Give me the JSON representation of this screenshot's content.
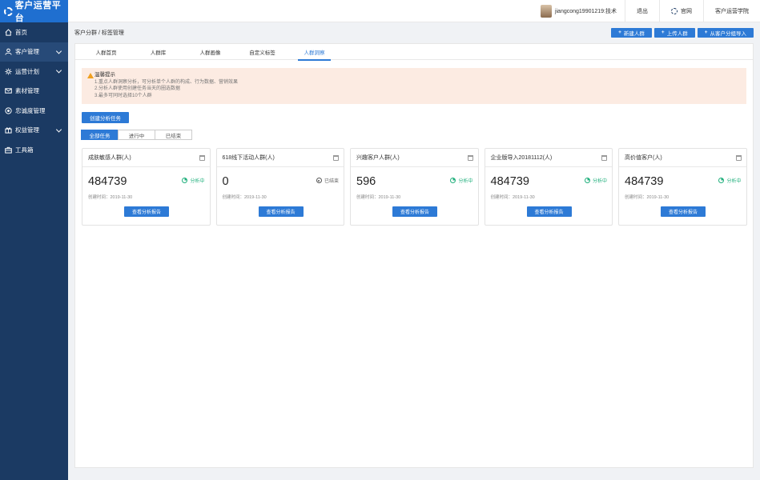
{
  "app": {
    "title": "客户运营平台"
  },
  "sidebar": {
    "items": [
      {
        "label": "首页",
        "icon": "home-icon",
        "expandable": false
      },
      {
        "label": "客户管理",
        "icon": "user-icon",
        "expandable": true
      },
      {
        "label": "运营计划",
        "icon": "gear-icon",
        "expandable": true
      },
      {
        "label": "素材管理",
        "icon": "mail-icon",
        "expandable": false
      },
      {
        "label": "忠诚度管理",
        "icon": "loyalty-icon",
        "expandable": false
      },
      {
        "label": "权益管理",
        "icon": "gift-icon",
        "expandable": true
      },
      {
        "label": "工具箱",
        "icon": "toolbox-icon",
        "expandable": false
      }
    ]
  },
  "topbar": {
    "user": "jiangcong19901219:技术",
    "logout": "退出",
    "official_site": "官网",
    "academy": "客户运营学院"
  },
  "breadcrumb": "客户分群 / 标签管理",
  "actions": {
    "new_group": "新建人群",
    "upload_group": "上传人群",
    "import_group": "从客户分组导入"
  },
  "tabs": [
    {
      "label": "人群首页",
      "active": false
    },
    {
      "label": "人群库",
      "active": false
    },
    {
      "label": "人群画像",
      "active": false
    },
    {
      "label": "自定义标签",
      "active": false
    },
    {
      "label": "人群洞察",
      "active": true
    }
  ],
  "tip": {
    "title": "温馨提示",
    "lines": [
      "1.重点人群洞察分析，可分析单个人群的构成、行为数据、营销效果",
      "2.分析人群使用创建任务当天的圈选数据",
      "3.最多可同时选择10个人群"
    ]
  },
  "create_task_label": "创建分析任务",
  "filter": {
    "options": [
      {
        "label": "全部任务",
        "active": true
      },
      {
        "label": "进行中",
        "active": false
      },
      {
        "label": "已结束",
        "active": false
      }
    ]
  },
  "cards": [
    {
      "name": "成肤敏感人群(人)",
      "count": "484739",
      "status": "分析中",
      "status_type": "running",
      "created": "创建时间：2019-11-30",
      "button": "查看分析报告"
    },
    {
      "name": "618线下活动人群(人)",
      "count": "0",
      "status": "已结束",
      "status_type": "done",
      "created": "创建时间：2019-11-30",
      "button": "查看分析报告"
    },
    {
      "name": "兴趣客户人群(人)",
      "count": "596",
      "status": "分析中",
      "status_type": "running",
      "created": "创建时间：2019-11-30",
      "button": "查看分析报告"
    },
    {
      "name": "企业版导入20181112(人)",
      "count": "484739",
      "status": "分析中",
      "status_type": "running",
      "created": "创建时间：2019-11-30",
      "button": "查看分析报告"
    },
    {
      "name": "高价值客户(人)",
      "count": "484739",
      "status": "分析中",
      "status_type": "running",
      "created": "创建时间：2019-11-30",
      "button": "查看分析报告"
    }
  ],
  "colors": {
    "primary": "#2d7ad6",
    "sidebar": "#1b3a63",
    "logo_bg": "#1f6fd0",
    "success": "#22b07d",
    "tip_bg": "#fcebe2"
  }
}
